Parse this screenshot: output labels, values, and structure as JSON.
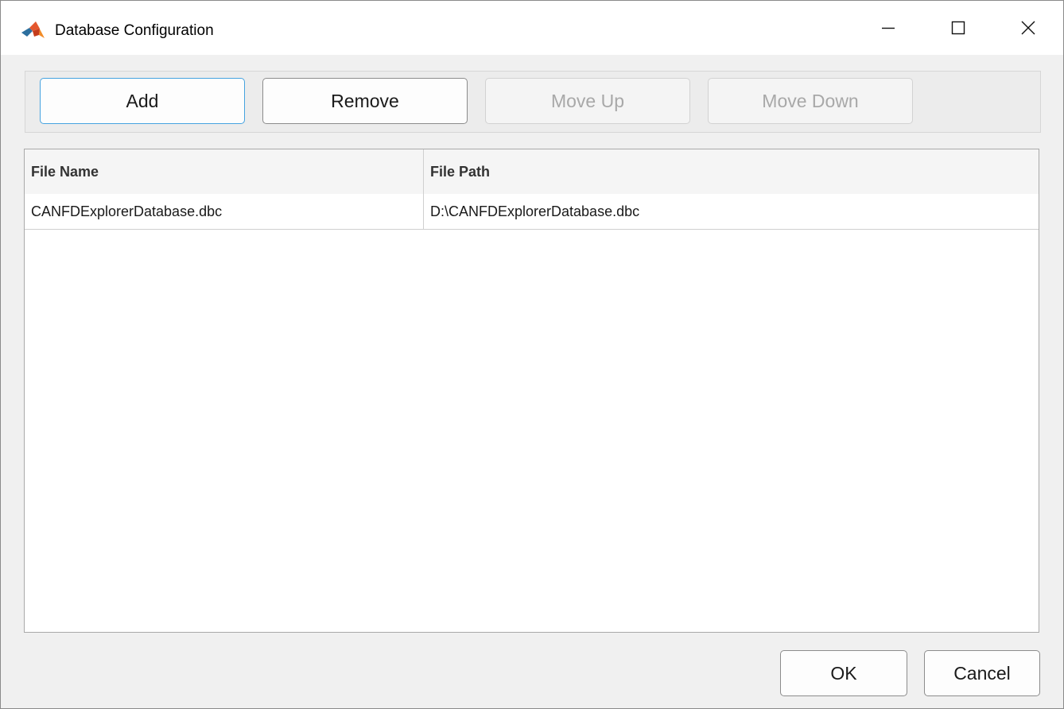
{
  "window": {
    "title": "Database Configuration",
    "app_icon": "matlab-logo-icon",
    "controls": {
      "minimize_icon": "minimize-icon",
      "maximize_icon": "maximize-icon",
      "close_icon": "close-icon"
    }
  },
  "toolbar": {
    "add_label": "Add",
    "remove_label": "Remove",
    "move_up_label": "Move Up",
    "move_down_label": "Move Down"
  },
  "table": {
    "columns": [
      "File Name",
      "File Path"
    ],
    "rows": [
      [
        "CANFDExplorerDatabase.dbc",
        "D:\\CANFDExplorerDatabase.dbc"
      ]
    ]
  },
  "footer": {
    "ok_label": "OK",
    "cancel_label": "Cancel"
  },
  "colors": {
    "accent_focus": "#46a3e0",
    "disabled_text": "#a8a8a8",
    "background": "#f0f0f0"
  }
}
